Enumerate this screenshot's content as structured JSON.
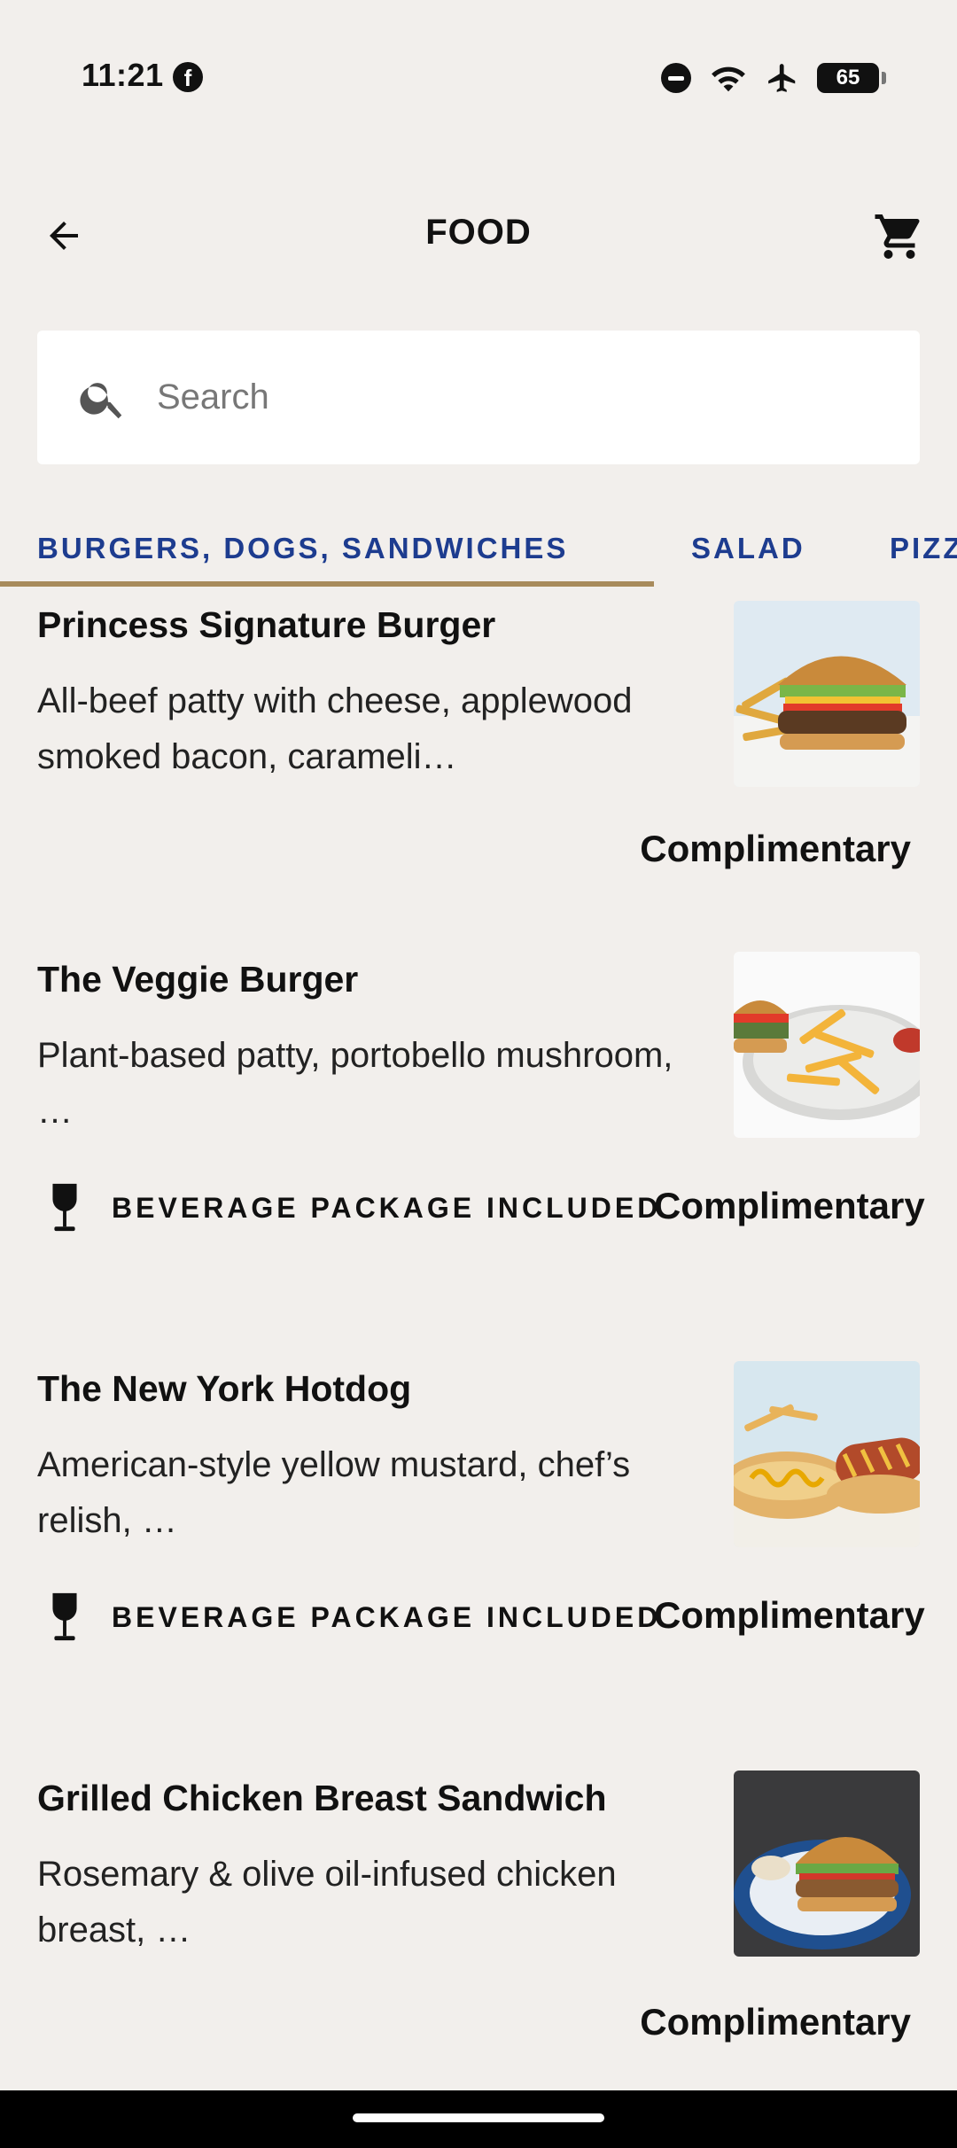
{
  "status_bar": {
    "time": "11:21",
    "battery": "65",
    "icons": [
      "facebook-icon",
      "do-not-disturb-icon",
      "wifi-icon",
      "airplane-icon",
      "battery-icon"
    ]
  },
  "app_bar": {
    "title": "FOOD",
    "icons": [
      "back-arrow-icon",
      "cart-icon"
    ]
  },
  "search": {
    "placeholder": "Search",
    "value": ""
  },
  "tabs": [
    {
      "label": "BURGERS, DOGS, SANDWICHES",
      "selected": true
    },
    {
      "label": "SALAD",
      "selected": false
    },
    {
      "label": "PIZZ",
      "selected": false
    }
  ],
  "colors": {
    "background": "#f2efec",
    "tab_text": "#1d3c8f",
    "tab_indicator": "#a88b5c"
  },
  "items": [
    {
      "name": "Princess Signature Burger",
      "description": "All-beef patty with cheese, applewood smoked bacon, carameli…",
      "price": "Complimentary",
      "beverage_label": "",
      "image": "burger-with-fries-image"
    },
    {
      "name": "The Veggie Burger",
      "description": "Plant-based patty, portobello mushroom, …",
      "price": "Complimentary",
      "beverage_label": "BEVERAGE PACKAGE INCLUDED",
      "image": "veggie-burger-with-fries-image"
    },
    {
      "name": "The New York Hotdog",
      "description": "American-style yellow mustard, chef’s relish, …",
      "price": "Complimentary",
      "beverage_label": "BEVERAGE PACKAGE INCLUDED",
      "image": "hotdog-image"
    },
    {
      "name": "Grilled Chicken Breast Sandwich",
      "description": "Rosemary & olive oil-infused chicken breast, …",
      "price": "Complimentary",
      "beverage_label": "",
      "image": "chicken-sandwich-image"
    }
  ]
}
